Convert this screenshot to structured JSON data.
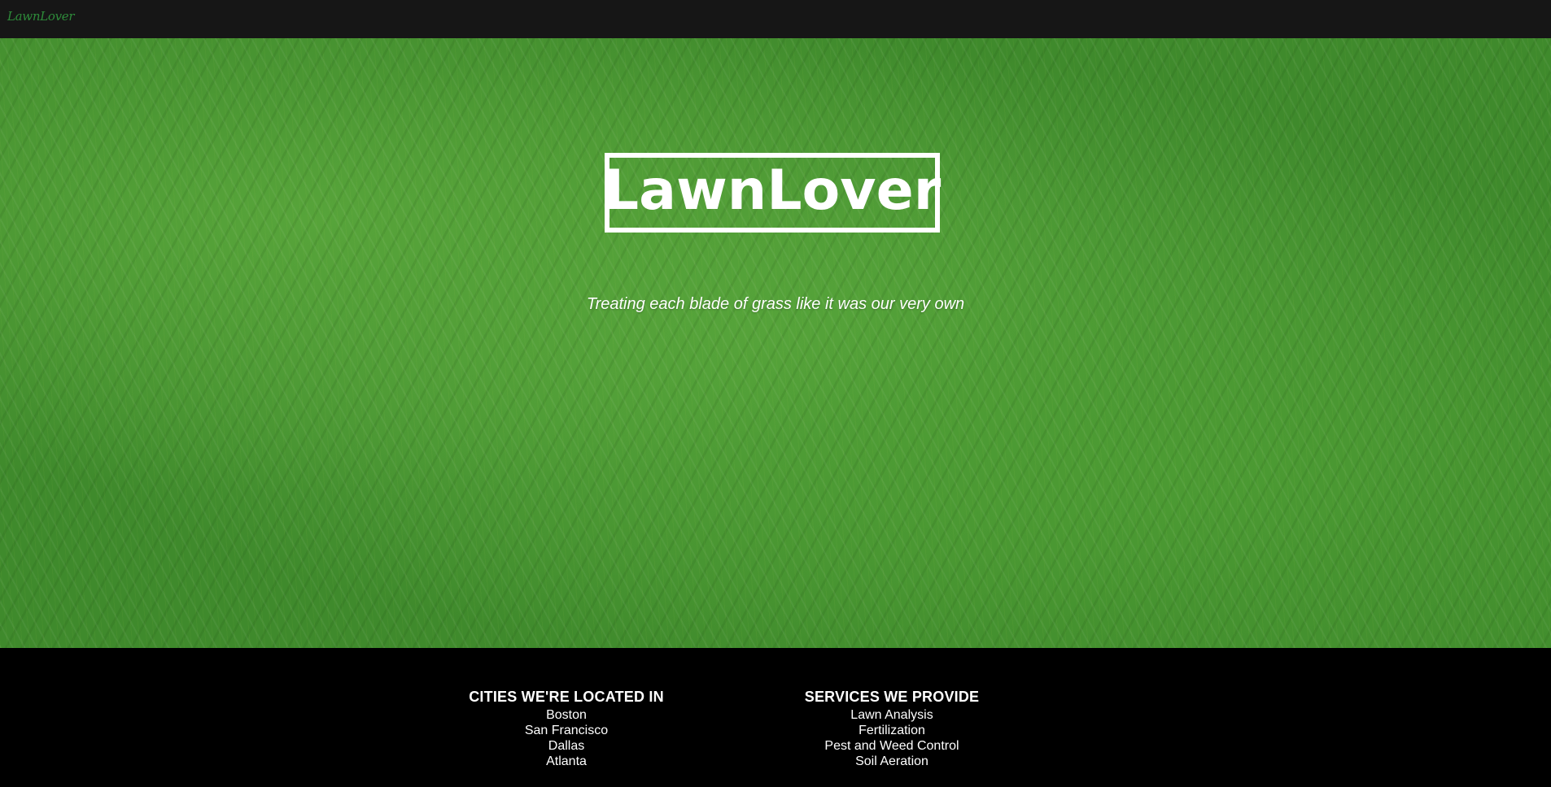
{
  "header": {
    "brand": "LawnLover"
  },
  "hero": {
    "logo_text": "LawnLover",
    "tagline": "Treating each blade of grass like it was our very own"
  },
  "footer": {
    "cities": {
      "heading": "CITIES WE'RE LOCATED IN",
      "items": [
        "Boston",
        "San Francisco",
        "Dallas",
        "Atlanta"
      ]
    },
    "services": {
      "heading": "SERVICES WE PROVIDE",
      "items": [
        "Lawn Analysis",
        "Fertilization",
        "Pest and Weed Control",
        "Soil Aeration"
      ]
    }
  },
  "colors": {
    "topbar": "#161616",
    "brand_green": "#2e8b3a",
    "footer": "#000000",
    "text": "#ffffff"
  }
}
